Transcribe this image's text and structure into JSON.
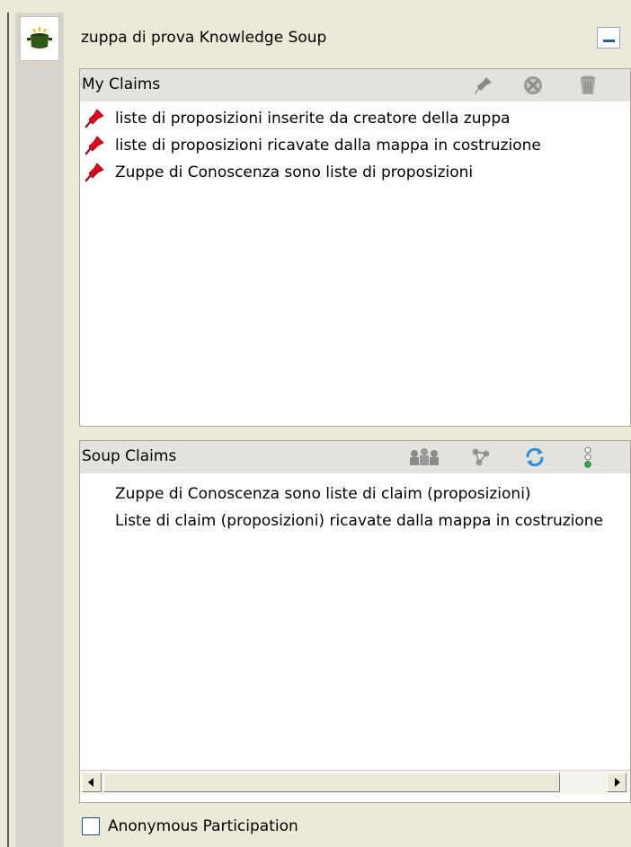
{
  "window": {
    "title": "zuppa di prova Knowledge Soup",
    "rail_icon": "soup-pot-icon",
    "minimize_icon": "minimize-icon"
  },
  "my_claims": {
    "header": "My Claims",
    "toolbar_icons": [
      "pin-icon",
      "forbid-icon",
      "trash-icon"
    ],
    "items": [
      "liste di proposizioni inserite da creatore della zuppa",
      "liste di proposizioni ricavate dalla mappa in costruzione",
      "Zuppe di Conoscenza sono liste di proposizioni"
    ]
  },
  "soup_claims": {
    "header": "Soup Claims",
    "toolbar_icons": [
      "group-people-icon",
      "network-icon",
      "refresh-icon",
      "traffic-light-icon"
    ],
    "items": [
      "Zuppe di Conoscenza sono liste di claim (proposizioni)",
      "Liste di claim (proposizioni) ricavate dalla mappa in costruzione"
    ]
  },
  "footer": {
    "anonymous_label": "Anonymous Participation",
    "anonymous_checked": false
  },
  "colors": {
    "background": "#ece9d8",
    "header_background": "#e4e2de",
    "accent_blue": "#2c5ba6",
    "pin_red": "#e0001a"
  }
}
